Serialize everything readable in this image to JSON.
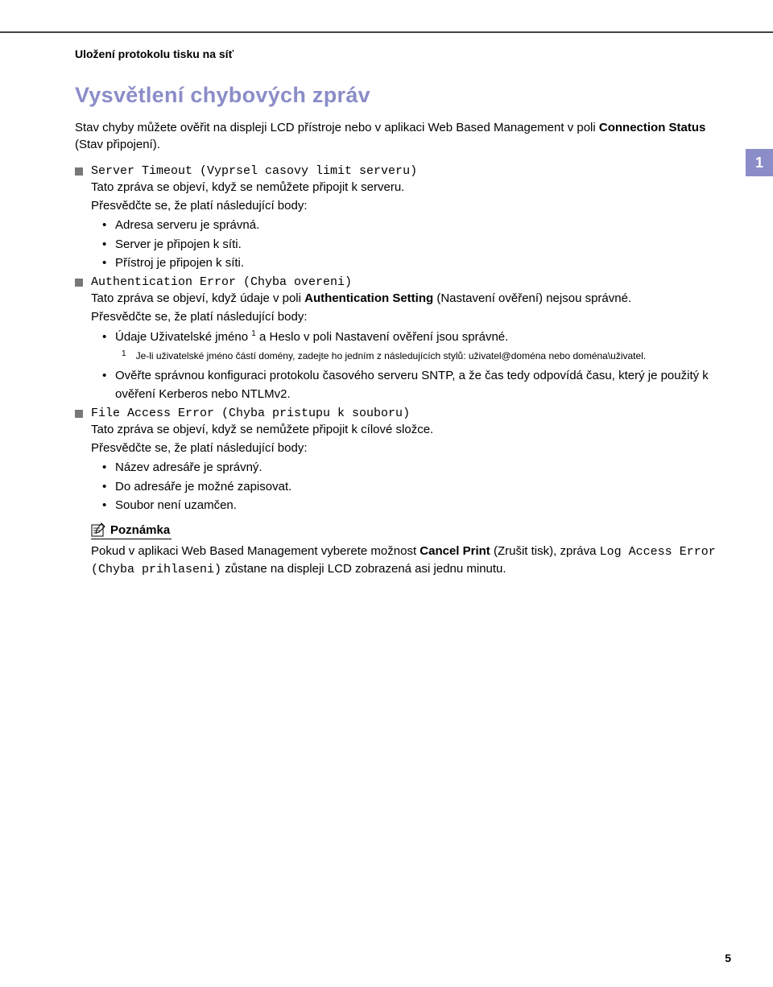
{
  "sideBadge": "1",
  "sectionHeader": "Uložení protokolu tisku na síť",
  "title": "Vysvětlení chybových zpráv",
  "intro": {
    "pre": "Stav chyby můžete ověřit na displeji LCD přístroje nebo v aplikaci Web Based Management v poli ",
    "bold": "Connection Status",
    "post": " (Stav připojení)."
  },
  "error1": {
    "code": "Server Timeout (Vyprsel casovy limit serveru)",
    "desc": "Tato zpráva se objeví, když se nemůžete připojit k serveru.",
    "check": "Přesvědčte se, že platí následující body:",
    "bullets": [
      "Adresa serveru je správná.",
      "Server je připojen k síti.",
      "Přístroj je připojen k síti."
    ]
  },
  "error2": {
    "code": "Authentication Error (Chyba overeni)",
    "desc_pre": "Tato zpráva se objeví, když údaje v poli ",
    "desc_bold": "Authentication Setting",
    "desc_post": " (Nastavení ověření) nejsou správné.",
    "check": "Přesvědčte se, že platí následující body:",
    "bullet1_pre": "Údaje Uživatelské jméno ",
    "bullet1_post": " a Heslo v poli Nastavení ověření jsou správné.",
    "footnote_num": "1",
    "footnote_text": "Je-li uživatelské jméno částí domény, zadejte ho jedním z následujících stylů: uživatel@doména nebo doména\\uživatel.",
    "bullet2": "Ověřte správnou konfiguraci protokolu časového serveru SNTP, a že čas tedy odpovídá času, který je použitý k ověření Kerberos nebo NTLMv2."
  },
  "error3": {
    "code": "File Access Error (Chyba pristupu k souboru)",
    "desc": "Tato zpráva se objeví, když se nemůžete připojit k cílové složce.",
    "check": "Přesvědčte se, že platí následující body:",
    "bullets": [
      "Název adresáře je správný.",
      "Do adresáře je možné zapisovat.",
      "Soubor není uzamčen."
    ]
  },
  "note": {
    "label": "Poznámka",
    "body_pre": "Pokud v aplikaci Web Based Management vyberete možnost ",
    "body_bold": "Cancel Print",
    "body_mid": " (Zrušit tisk), zpráva ",
    "body_mono": "Log Access Error (Chyba prihlaseni)",
    "body_post": " zůstane na displeji LCD zobrazená asi jednu minutu."
  },
  "pageNumber": "5"
}
